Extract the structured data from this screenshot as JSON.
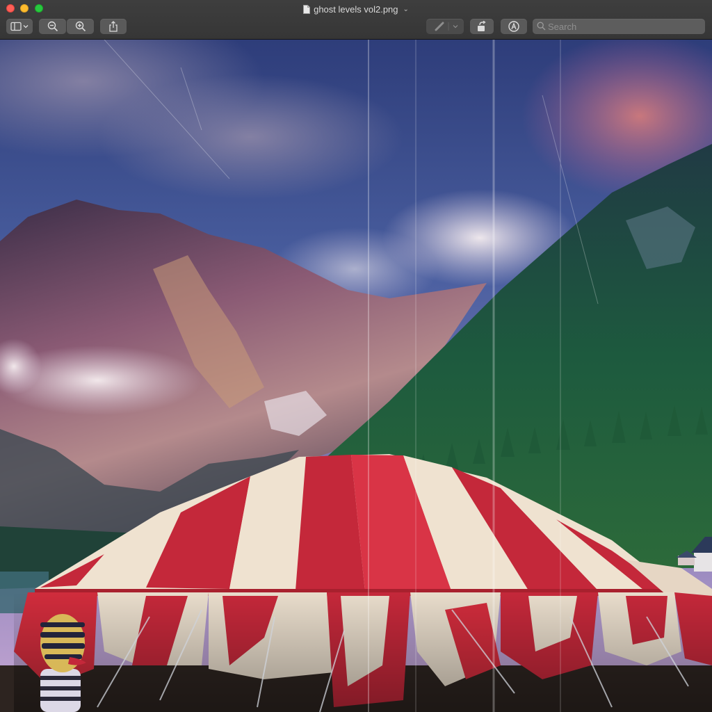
{
  "window": {
    "title": "ghost levels vol2.png",
    "title_chevron": "⌄"
  },
  "toolbar": {
    "sidebar_button_icon": "sidebar-icon",
    "zoom_out_icon": "zoom-out-icon",
    "zoom_in_icon": "zoom-in-icon",
    "share_icon": "share-icon",
    "highlight_pen_icon": "pen-icon",
    "rotate_icon": "rotate-icon",
    "markup_icon": "markup-icon"
  },
  "search": {
    "placeholder": "Search",
    "value": ""
  },
  "colors": {
    "close": "#fe5f57",
    "minimize": "#febc2e",
    "maximize": "#28c840",
    "toolbar": "#3b3b3b",
    "tent_red": "#c4283a",
    "tent_cream": "#efe2d0"
  }
}
